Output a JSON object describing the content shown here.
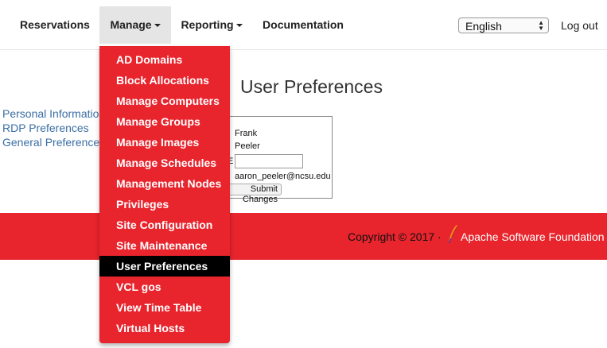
{
  "nav": {
    "reservations": "Reservations",
    "manage": "Manage",
    "reporting": "Reporting",
    "documentation": "Documentation",
    "language": "English",
    "logout": "Log out"
  },
  "manage_menu": {
    "items": [
      "AD Domains",
      "Block Allocations",
      "Manage Computers",
      "Manage Groups",
      "Manage Images",
      "Manage Schedules",
      "Management Nodes",
      "Privileges",
      "Site Configuration",
      "Site Maintenance",
      "User Preferences",
      "VCL gos",
      "View Time Table",
      "Virtual Hosts"
    ],
    "selected": "User Preferences"
  },
  "sidebar": {
    "links": [
      "Personal Information",
      "RDP Preferences",
      "General Preferences"
    ]
  },
  "main": {
    "title": "User Preferences",
    "first_name": "Frank",
    "last_name": "Peeler",
    "email_field_label": "E",
    "email_value": "aaron_peeler@ncsu.edu",
    "submit_label": "Submit Changes"
  },
  "footer": {
    "copyright": "Copyright © 2017 ·",
    "foundation": "Apache Software Foundation"
  },
  "colors": {
    "brand_red": "#e8242d",
    "link_blue": "#3a6ea5",
    "selected_item": "#000000"
  }
}
